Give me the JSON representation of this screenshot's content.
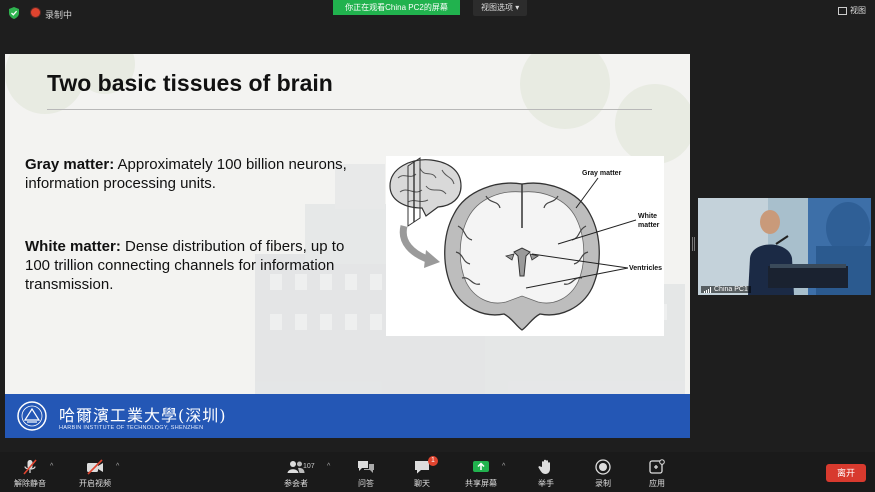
{
  "topbar": {
    "recording_label": "录制中",
    "share_banner": "你正在观看China PC2的屏幕",
    "view_options": "视图选项",
    "view_button": "视图"
  },
  "slide": {
    "title": "Two basic tissues of brain",
    "gray_label": "Gray matter:",
    "gray_text": " Approximately 100 billion neurons, information processing units.",
    "white_label": "White matter:",
    "white_text": " Dense distribution of fibers, up to 100 trillion connecting channels for information transmission.",
    "figure_labels": {
      "gray": "Gray matter",
      "white_1": "White",
      "white_2": "matter",
      "ventricles": "Ventricles"
    },
    "footer": {
      "university_cn": "哈爾濱工業大學(深圳)",
      "university_en": "HARBIN INSTITUTE OF TECHNOLOGY, SHENZHEN"
    }
  },
  "video_tile": {
    "participant_name": "China PC1"
  },
  "toolbar": {
    "unmute": "解除静音",
    "start_video": "开启视频",
    "participants": "参会者",
    "participants_count": "107",
    "qa": "问答",
    "chat": "聊天",
    "chat_badge": "1",
    "share_screen": "共享屏幕",
    "raise_hand": "举手",
    "record": "录制",
    "apps": "应用",
    "leave": "离开"
  },
  "colors": {
    "share_green": "#21b24e",
    "footer_blue": "#2457b5",
    "leave_red": "#d83a2e",
    "badge_red": "#e0442f"
  }
}
